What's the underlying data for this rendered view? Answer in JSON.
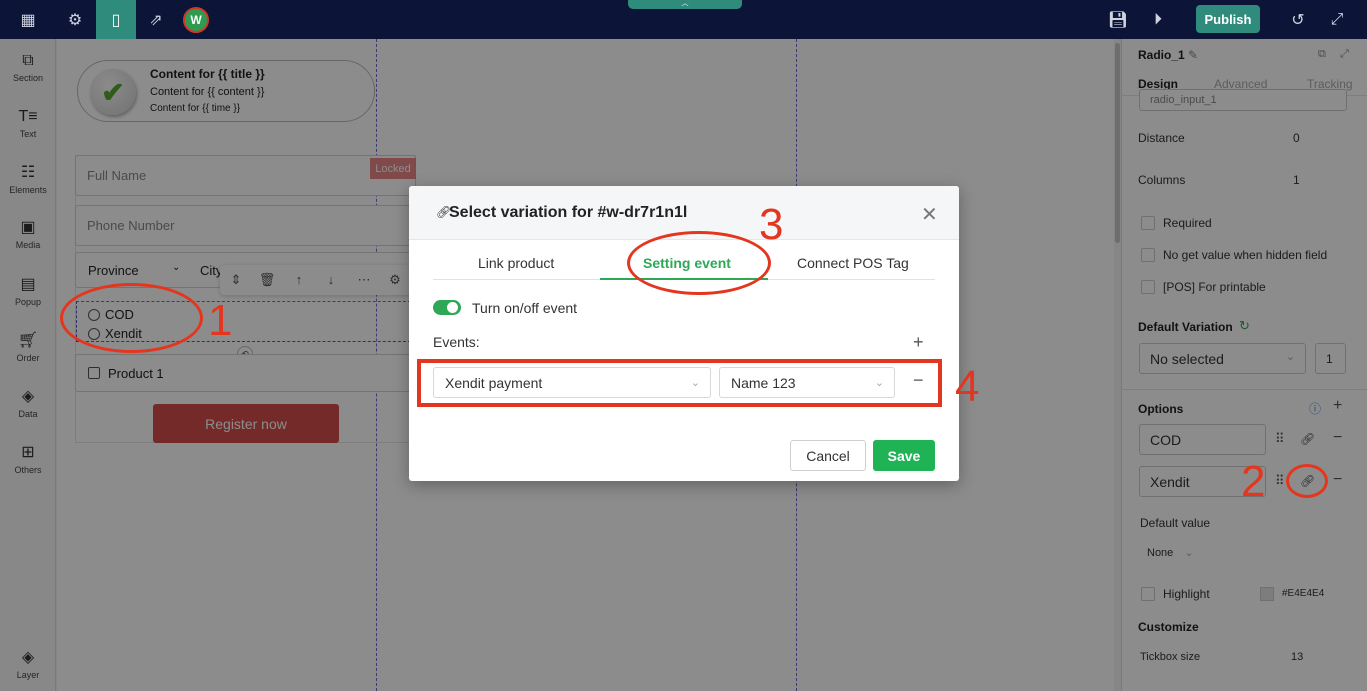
{
  "topbar": {
    "icons": [
      "grid-icon",
      "gear-icon",
      "mobile-icon",
      "share-icon"
    ],
    "logo_text": "W",
    "collapse_icon": "chevron-up-icon",
    "right_icons": [
      "save-icon",
      "play-icon",
      "history-icon",
      "fullscreen-icon"
    ],
    "publish_label": "Publish"
  },
  "sidebar": {
    "items": [
      {
        "label": "Section",
        "icon": "section-icon"
      },
      {
        "label": "Text",
        "icon": "text-icon"
      },
      {
        "label": "Elements",
        "icon": "elements-icon"
      },
      {
        "label": "Media",
        "icon": "media-icon"
      },
      {
        "label": "Popup",
        "icon": "popup-icon"
      },
      {
        "label": "Order",
        "icon": "cart-icon"
      },
      {
        "label": "Data",
        "icon": "layers-icon"
      },
      {
        "label": "Others",
        "icon": "others-icon"
      }
    ],
    "layer_label": "Layer"
  },
  "canvas": {
    "notification": {
      "title": "Content for {{ title }}",
      "content": "Content for {{ content }}",
      "time": "Content for {{ time }}"
    },
    "form": {
      "full_name_placeholder": "Full Name",
      "locked_label": "Locked",
      "phone_placeholder": "Phone Number",
      "province_label": "Province",
      "city_label": "City",
      "radio_options": [
        "COD",
        "Xendit"
      ],
      "product_label": "Product 1",
      "register_label": "Register now"
    }
  },
  "right_panel": {
    "title": "Radio_1",
    "tabs": [
      "Design",
      "Advanced",
      "Tracking"
    ],
    "input_name_value": "radio_input_1",
    "distance_label": "Distance",
    "distance_value": "0",
    "columns_label": "Columns",
    "columns_value": "1",
    "checkboxes": [
      "Required",
      "No get value when hidden field",
      "[POS] For printable"
    ],
    "default_variation_label": "Default Variation",
    "default_variation_value": "No selected",
    "default_variation_qty": "1",
    "options_label": "Options",
    "options": [
      "COD",
      "Xendit"
    ],
    "default_value_label": "Default value",
    "default_value": "None",
    "highlight_label": "Highlight",
    "highlight_color": "#E4E4E4",
    "customize_label": "Customize",
    "tickbox_size_label": "Tickbox size",
    "tickbox_size_value": "13"
  },
  "modal": {
    "title": "Select variation for #w-dr7r1n1l",
    "tabs": [
      "Link product",
      "Setting event",
      "Connect POS Tag"
    ],
    "active_tab": "Setting event",
    "toggle_label": "Turn on/off event",
    "toggle_on": true,
    "events_label": "Events:",
    "event_type": "Xendit payment",
    "event_name": "Name 123",
    "cancel_label": "Cancel",
    "save_label": "Save"
  },
  "annotations": [
    "1",
    "2",
    "3",
    "4"
  ],
  "colors": {
    "topbar": "#0c1437",
    "accent_teal": "#2f8c7c",
    "accent_green": "#2ea857",
    "annotation_red": "#e4361f",
    "register_red": "#d64d4d"
  }
}
